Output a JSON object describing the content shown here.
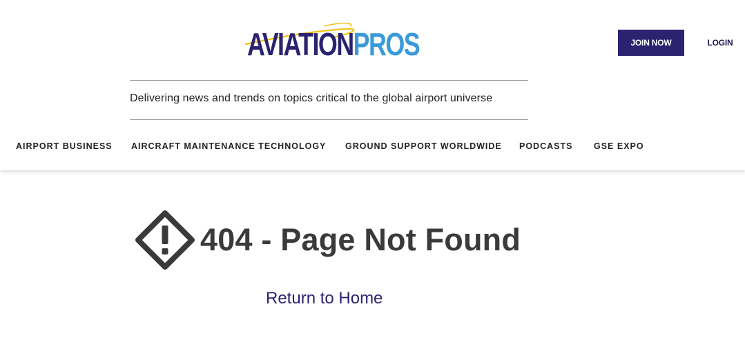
{
  "header": {
    "logo": {
      "part1": "AVIATION",
      "part2": "PROS",
      "tm": "™"
    },
    "join_label": "JOIN NOW",
    "login_label": "LOGIN",
    "tagline": "Delivering news and trends on topics critical to the global airport universe",
    "nav": [
      {
        "label": "AIRPORT BUSINESS"
      },
      {
        "label": "AIRCRAFT MAINTENANCE TECHNOLOGY"
      },
      {
        "label": "GROUND SUPPORT WORLDWIDE"
      },
      {
        "label": "PODCASTS"
      },
      {
        "label": "GSE EXPO"
      }
    ]
  },
  "main": {
    "icon": "warning-diamond-icon",
    "title": "404 - Page Not Found",
    "return_link": "Return to Home"
  },
  "colors": {
    "brand_dark": "#2b2370",
    "brand_light": "#3a9ad9",
    "logo_swoosh": "#f2c21b",
    "heading": "#3a3a3a"
  }
}
